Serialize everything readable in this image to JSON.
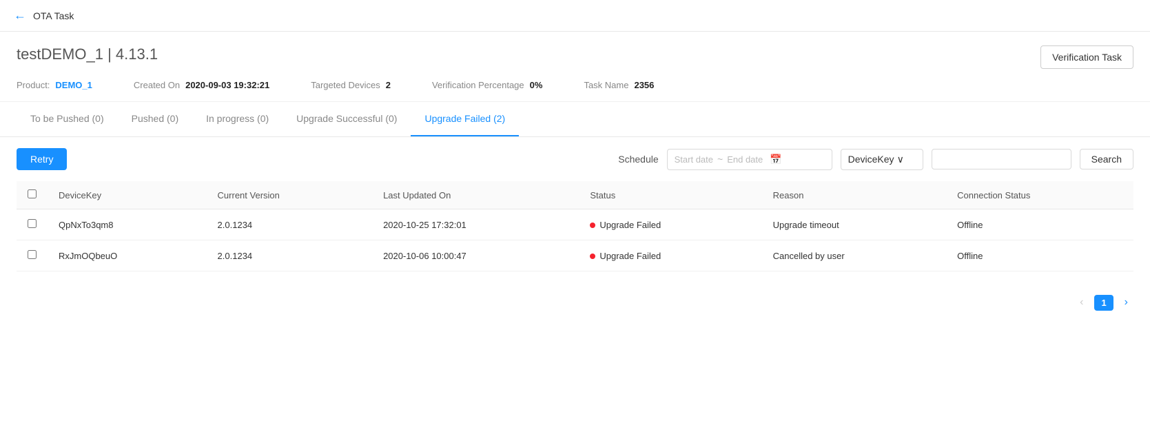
{
  "nav": {
    "back_icon": "←",
    "title": "OTA Task"
  },
  "header": {
    "main_title": "testDEMO_1",
    "version": "4.13.1",
    "verification_task_btn": "Verification Task",
    "product_label": "Product:",
    "product_value": "DEMO_1",
    "created_on_label": "Created On",
    "created_on_value": "2020-09-03 19:32:21",
    "targeted_devices_label": "Targeted Devices",
    "targeted_devices_value": "2",
    "verification_percentage_label": "Verification Percentage",
    "verification_percentage_value": "0%",
    "task_name_label": "Task Name",
    "task_name_value": "2356"
  },
  "tabs": [
    {
      "label": "To be Pushed (0)",
      "active": false
    },
    {
      "label": "Pushed (0)",
      "active": false
    },
    {
      "label": "In progress (0)",
      "active": false
    },
    {
      "label": "Upgrade Successful (0)",
      "active": false
    },
    {
      "label": "Upgrade Failed (2)",
      "active": true
    }
  ],
  "toolbar": {
    "retry_label": "Retry",
    "schedule_label": "Schedule",
    "start_date_placeholder": "Start date",
    "end_date_placeholder": "End date",
    "date_sep": "~",
    "calendar_icon": "📅",
    "device_key_label": "DeviceKey",
    "dropdown_icon": "⌄",
    "search_label": "Search"
  },
  "table": {
    "columns": [
      "",
      "DeviceKey",
      "Current Version",
      "Last Updated On",
      "Status",
      "Reason",
      "Connection Status"
    ],
    "rows": [
      {
        "id": "row1",
        "device_key": "QpNxTo3qm8",
        "current_version": "2.0.1234",
        "last_updated_on": "2020-10-25 17:32:01",
        "status": "Upgrade Failed",
        "reason": "Upgrade timeout",
        "connection_status": "Offline"
      },
      {
        "id": "row2",
        "device_key": "RxJmOQbeuO",
        "current_version": "2.0.1234",
        "last_updated_on": "2020-10-06 10:00:47",
        "status": "Upgrade Failed",
        "reason": "Cancelled by user",
        "connection_status": "Offline"
      }
    ]
  },
  "pagination": {
    "prev_icon": "‹",
    "next_icon": "›",
    "current_page": "1"
  }
}
